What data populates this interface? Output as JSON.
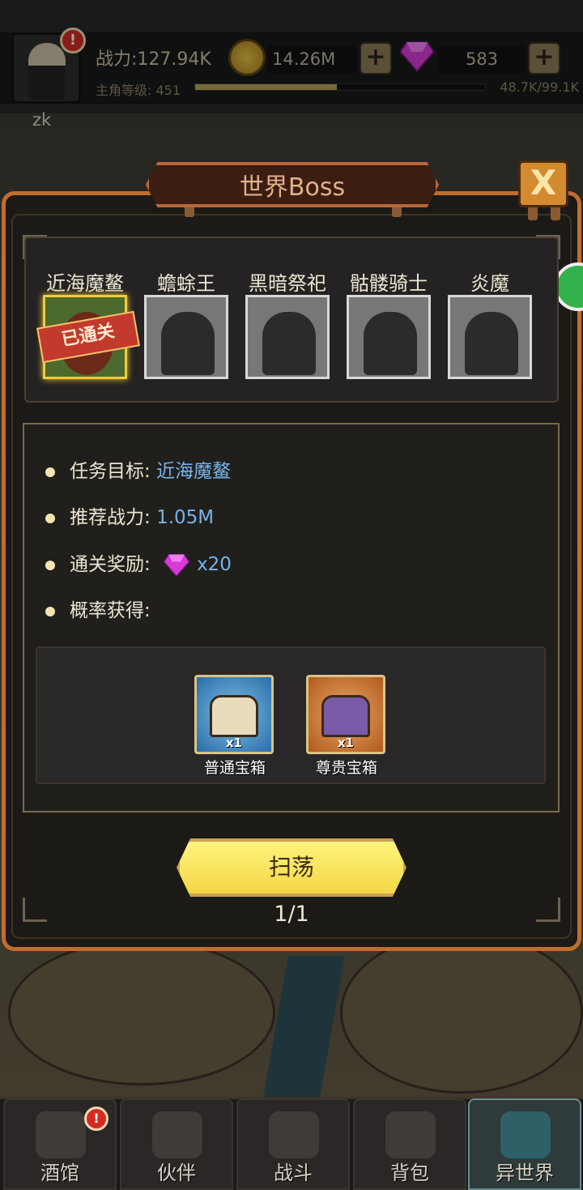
{
  "player": {
    "name": "zk",
    "power": "战力:127.94K",
    "level_label": "主角等级: 451",
    "xp_text": "48.7K/99.1K",
    "xp_fraction": 0.49
  },
  "currencies": {
    "gold": "14.26M",
    "gems": "583",
    "plus": "+"
  },
  "dialog": {
    "title": "世界Boss",
    "close": "X"
  },
  "bosses": [
    {
      "name": "近海魔鳌",
      "cleared": true
    },
    {
      "name": "蟾蜍王",
      "cleared": false
    },
    {
      "name": "黑暗祭祀",
      "cleared": false
    },
    {
      "name": "骷髅骑士",
      "cleared": false
    },
    {
      "name": "炎魔",
      "cleared": false
    }
  ],
  "cleared_stamp": "已通关",
  "info": {
    "target_label": "任务目标:",
    "target_value": "近海魔鳌",
    "power_label": "推荐战力:",
    "power_value": "1.05M",
    "reward_label": "通关奖励:",
    "reward_value": "x20",
    "drop_label": "概率获得:"
  },
  "chests": [
    {
      "name": "普通宝箱",
      "qty": "x1",
      "color": "#2a6ca6"
    },
    {
      "name": "尊贵宝箱",
      "qty": "x1",
      "color": "#b25a1c"
    }
  ],
  "sweep": {
    "label": "扫荡",
    "count": "1/1"
  },
  "nav": [
    {
      "label": "酒馆",
      "active": false
    },
    {
      "label": "伙伴",
      "active": false
    },
    {
      "label": "战斗",
      "active": false
    },
    {
      "label": "背包",
      "active": false
    },
    {
      "label": "异世界",
      "active": true
    }
  ],
  "alert_mark": "!",
  "colors": {
    "panel_border": "#c06d2e",
    "highlight_value": "#76b3eb",
    "button_yellow": "#f3d746",
    "gem": "#d63bd8"
  }
}
